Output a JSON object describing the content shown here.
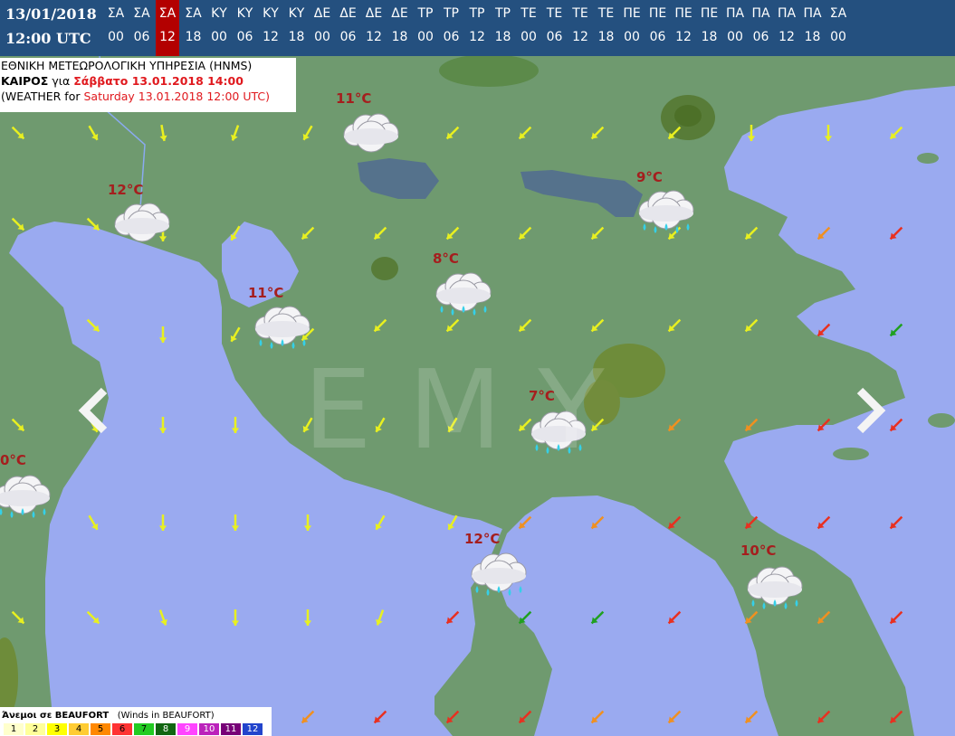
{
  "header": {
    "date": "13/01/2018",
    "utc": "12:00 UTC",
    "days": [
      "ΣΑ",
      "ΣΑ",
      "ΣΑ",
      "ΣΑ",
      "ΚΥ",
      "ΚΥ",
      "ΚΥ",
      "ΚΥ",
      "ΔΕ",
      "ΔΕ",
      "ΔΕ",
      "ΔΕ",
      "ΤΡ",
      "ΤΡ",
      "ΤΡ",
      "ΤΡ",
      "ΤΕ",
      "ΤΕ",
      "ΤΕ",
      "ΤΕ",
      "ΠΕ",
      "ΠΕ",
      "ΠΕ",
      "ΠΕ",
      "ΠΑ",
      "ΠΑ",
      "ΠΑ",
      "ΠΑ",
      "ΣΑ"
    ],
    "hours": [
      "00",
      "06",
      "12",
      "18",
      "00",
      "06",
      "12",
      "18",
      "00",
      "06",
      "12",
      "18",
      "00",
      "06",
      "12",
      "18",
      "00",
      "06",
      "12",
      "18",
      "00",
      "06",
      "12",
      "18",
      "00",
      "06",
      "12",
      "18",
      "00"
    ],
    "selected_index": 2,
    "selected_color": "#b30000"
  },
  "info": {
    "agency": "ΕΘΝΙΚΗ ΜΕΤΕΩΡΟΛΟΓΙΚΗ ΥΠΗΡΕΣΙΑ (HNMS)",
    "weather_label": "ΚΑΙΡΟΣ",
    "for_label": "για",
    "local_date": "Σάββατο 13.01.2018 14:00",
    "weather_for": "(WEATHER for",
    "utc_date": "Saturday 13.01.2018 12:00 UTC)"
  },
  "watermark": "EMY",
  "temperatures": [
    {
      "label": "11°C",
      "icon": "cloud-icon"
    },
    {
      "label": "12°C",
      "icon": "cloud-icon"
    },
    {
      "label": "9°C",
      "icon": "rain-cloud-icon"
    },
    {
      "label": "8°C",
      "icon": "rain-cloud-icon"
    },
    {
      "label": "11°C",
      "icon": "rain-cloud-icon"
    },
    {
      "label": "7°C",
      "icon": "rain-cloud-icon"
    },
    {
      "label": "0°C",
      "icon": "rain-cloud-icon"
    },
    {
      "label": "12°C",
      "icon": "rain-cloud-icon"
    },
    {
      "label": "10°C",
      "icon": "rain-cloud-icon"
    }
  ],
  "legend": {
    "title": "Άνεμοι σε BEAUFORT",
    "subtitle": "(Winds in BEAUFORT)",
    "scale": [
      "1",
      "2",
      "3",
      "4",
      "5",
      "6",
      "7",
      "8",
      "9",
      "10",
      "11",
      "12"
    ],
    "colors": [
      "#ffffcc",
      "#ffff99",
      "#ffff00",
      "#ffcc33",
      "#ff8800",
      "#ff3333",
      "#22cc22",
      "#116611",
      "#ff44ff",
      "#bb22bb",
      "#770077",
      "#2244cc"
    ]
  },
  "wind_colors": {
    "yellow": "#e8f020",
    "orange": "#f09020",
    "red": "#e83020",
    "green": "#20a020"
  }
}
